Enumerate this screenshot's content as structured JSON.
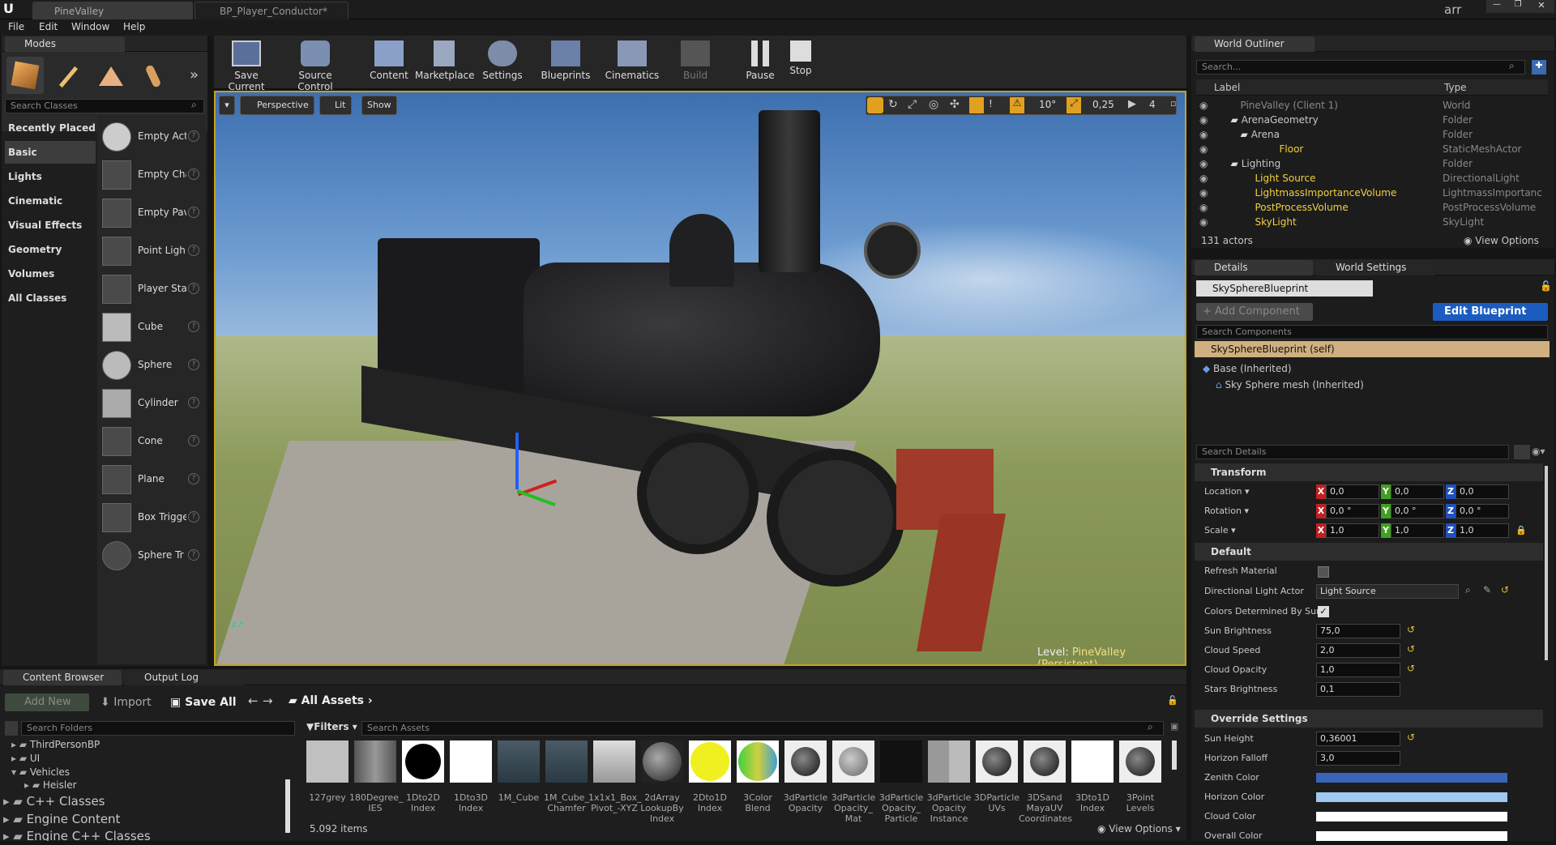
{
  "title_tabs": [
    "PineValley",
    "BP_Player_Conductor*"
  ],
  "title_right_text": "arr",
  "menu": [
    "File",
    "Edit",
    "Window",
    "Help"
  ],
  "modes": {
    "tab": "Modes",
    "search_placeholder": "Search Classes",
    "categories": [
      "Recently Placed",
      "Basic",
      "Lights",
      "Cinematic",
      "Visual Effects",
      "Geometry",
      "Volumes",
      "All Classes"
    ],
    "items": [
      "Empty Act",
      "Empty Cha",
      "Empty Pav",
      "Point Ligh",
      "Player Sta",
      "Cube",
      "Sphere",
      "Cylinder",
      "Cone",
      "Plane",
      "Box Trigge",
      "Sphere Tr"
    ]
  },
  "toolbar": [
    "Save Current",
    "Source Control",
    "Content",
    "Marketplace",
    "Settings",
    "Blueprints",
    "Cinematics",
    "Build",
    "Pause",
    "Stop"
  ],
  "viewport": {
    "perspective": "Perspective",
    "lit": "Lit",
    "show": "Show",
    "angle": "10°",
    "scale": "0,25",
    "speed": "4",
    "level_label": "Level:",
    "level_name": "PineValley (Persistent)"
  },
  "outliner": {
    "tab": "World Outliner",
    "search_placeholder": "Search...",
    "col_label": "Label",
    "col_type": "Type",
    "rows": [
      {
        "label": "PineValley (Client 1)",
        "type": "World"
      },
      {
        "label": "ArenaGeometry",
        "type": "Folder"
      },
      {
        "label": "Arena",
        "type": "Folder"
      },
      {
        "label": "Floor",
        "type": "StaticMeshActor"
      },
      {
        "label": "Lighting",
        "type": "Folder"
      },
      {
        "label": "Light Source",
        "type": "DirectionalLight"
      },
      {
        "label": "LightmassImportanceVolume",
        "type": "LightmassImportanc"
      },
      {
        "label": "PostProcessVolume",
        "type": "PostProcessVolume"
      },
      {
        "label": "SkyLight",
        "type": "SkyLight"
      }
    ],
    "count": "131 actors",
    "view_options": "View Options"
  },
  "details": {
    "tab_details": "Details",
    "tab_world": "World Settings",
    "object_name": "SkySphereBlueprint",
    "add_component": "+ Add Component",
    "edit_blueprint": "Edit Blueprint",
    "search_components": "Search Components",
    "components": [
      "SkySphereBlueprint (self)",
      "Base (Inherited)",
      "Sky Sphere mesh (Inherited)"
    ],
    "search_details": "Search Details",
    "transform": "Transform",
    "location": "Location",
    "rotation": "Rotation",
    "scale": "Scale",
    "loc": [
      "0,0",
      "0,0",
      "0,0"
    ],
    "rot": [
      "0,0 °",
      "0,0 °",
      "0,0 °"
    ],
    "scl": [
      "1,0",
      "1,0",
      "1,0"
    ],
    "default": "Default",
    "props": [
      {
        "label": "Refresh Material",
        "value": ""
      },
      {
        "label": "Directional Light Actor",
        "value": "Light Source"
      },
      {
        "label": "Colors Determined By Sun",
        "value": ""
      },
      {
        "label": "Sun Brightness",
        "value": "75,0"
      },
      {
        "label": "Cloud Speed",
        "value": "2,0"
      },
      {
        "label": "Cloud Opacity",
        "value": "1,0"
      },
      {
        "label": "Stars Brightness",
        "value": "0,1"
      }
    ],
    "override": "Override Settings",
    "oprops": [
      {
        "label": "Sun Height",
        "value": "0,36001"
      },
      {
        "label": "Horizon Falloff",
        "value": "3,0"
      },
      {
        "label": "Zenith Color",
        "value": ""
      },
      {
        "label": "Horizon Color",
        "value": ""
      },
      {
        "label": "Cloud Color",
        "value": ""
      },
      {
        "label": "Overall Color",
        "value": ""
      }
    ],
    "zenith_color": "#3a64b8",
    "horizon_color": "#a0c8ee",
    "cloud_color": "#ffffff",
    "overall_color": "#ffffff"
  },
  "content_browser": {
    "tab": "Content Browser",
    "tab_output": "Output Log",
    "add_new": "Add New",
    "import": "Import",
    "save_all": "Save All",
    "path": "All Assets",
    "search_folders": "Search Folders",
    "filters": "Filters",
    "search_assets": "Search Assets",
    "folders": [
      "ThirdPersonBP",
      "UI",
      "Vehicles",
      "Heisler",
      "C++ Classes",
      "Engine Content",
      "Engine C++ Classes"
    ],
    "assets": [
      "127grey",
      "180Degree_ IES",
      "1Dto2D Index",
      "1Dto3D Index",
      "1M_Cube",
      "1M_Cube_ Chamfer",
      "1x1x1_Box_ Pivot_-XYZ",
      "2dArray LookupBy Index",
      "2Dto1D Index",
      "3Color Blend",
      "3dParticle Opacity",
      "3dParticle Opacity_ Mat",
      "3dParticle Opacity_ Particle",
      "3dParticle Opacity Instance",
      "3DParticle UVs",
      "3DSand MayaUV Coordinates",
      "3Dto1D Index",
      "3Point Levels"
    ],
    "count": "5.092 items",
    "view_options": "View Options"
  }
}
